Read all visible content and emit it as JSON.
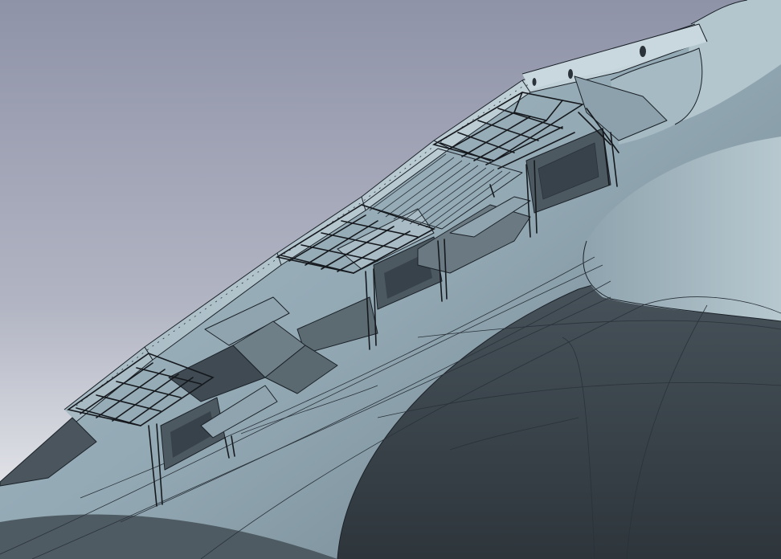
{
  "scene": {
    "colors": {
      "sky_top": "#8f93a8",
      "sky_mid": "#b9bcc8",
      "sky_bottom": "#f4f5f7",
      "hull_light": "#b9cbd3",
      "hull_mid": "#8ea5b0",
      "hull_dark": "#3e4850",
      "hull_darkest": "#2f383f",
      "sponson_shade": "#5f6d75",
      "deck_edge": "#c7d6dc",
      "edge_line": "#1b2128"
    },
    "structure_icons": [
      "flight-deck",
      "elevator-opening",
      "deck-edge-sponson",
      "support-strut",
      "catwalk-truss",
      "hull-plating"
    ]
  }
}
